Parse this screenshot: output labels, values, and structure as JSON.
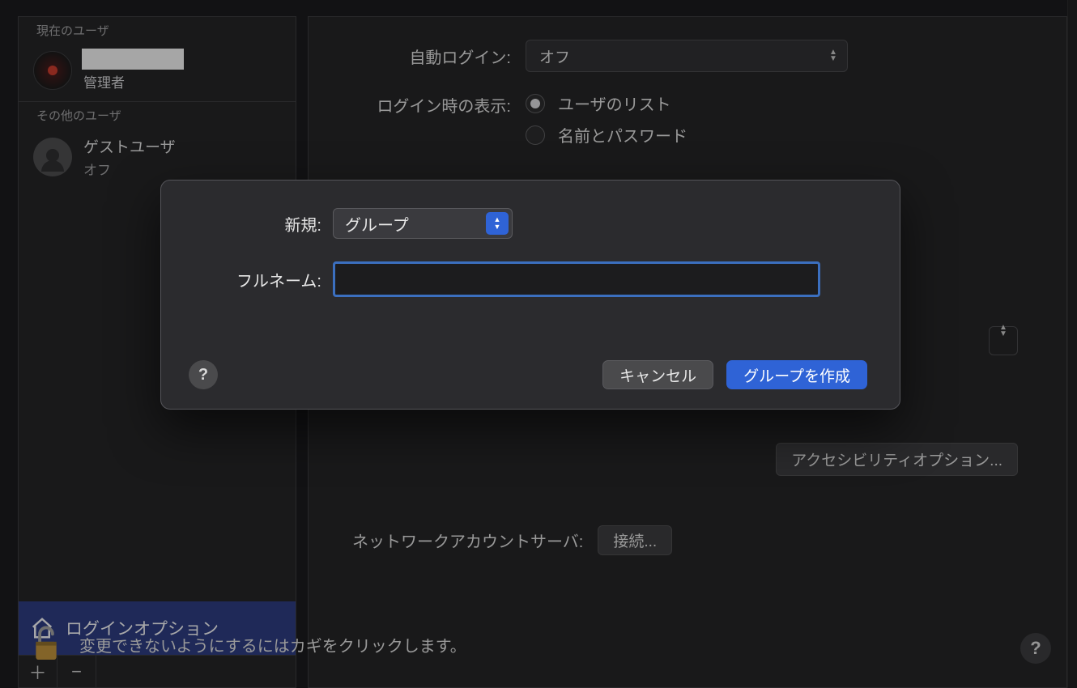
{
  "sidebar": {
    "current_section": "現在のユーザ",
    "current_user_role": "管理者",
    "other_section": "その他のユーザ",
    "guest_name": "ゲストユーザ",
    "guest_status": "オフ",
    "login_options": "ログインオプション"
  },
  "main": {
    "auto_login_label": "自動ログイン:",
    "auto_login_value": "オフ",
    "login_display_label": "ログイン時の表示:",
    "radio_user_list": "ユーザのリスト",
    "radio_name_password": "名前とパスワード",
    "accessibility_button": "アクセシビリティオプション...",
    "network_label": "ネットワークアカウントサーバ:",
    "connect_button": "接続..."
  },
  "lock": {
    "text": "変更できないようにするにはカギをクリックします。"
  },
  "dialog": {
    "new_label": "新規:",
    "new_value": "グループ",
    "fullname_label": "フルネーム:",
    "fullname_value": "",
    "cancel": "キャンセル",
    "create": "グループを作成"
  },
  "icons": {
    "plus": "＋",
    "minus": "−",
    "help": "?"
  }
}
